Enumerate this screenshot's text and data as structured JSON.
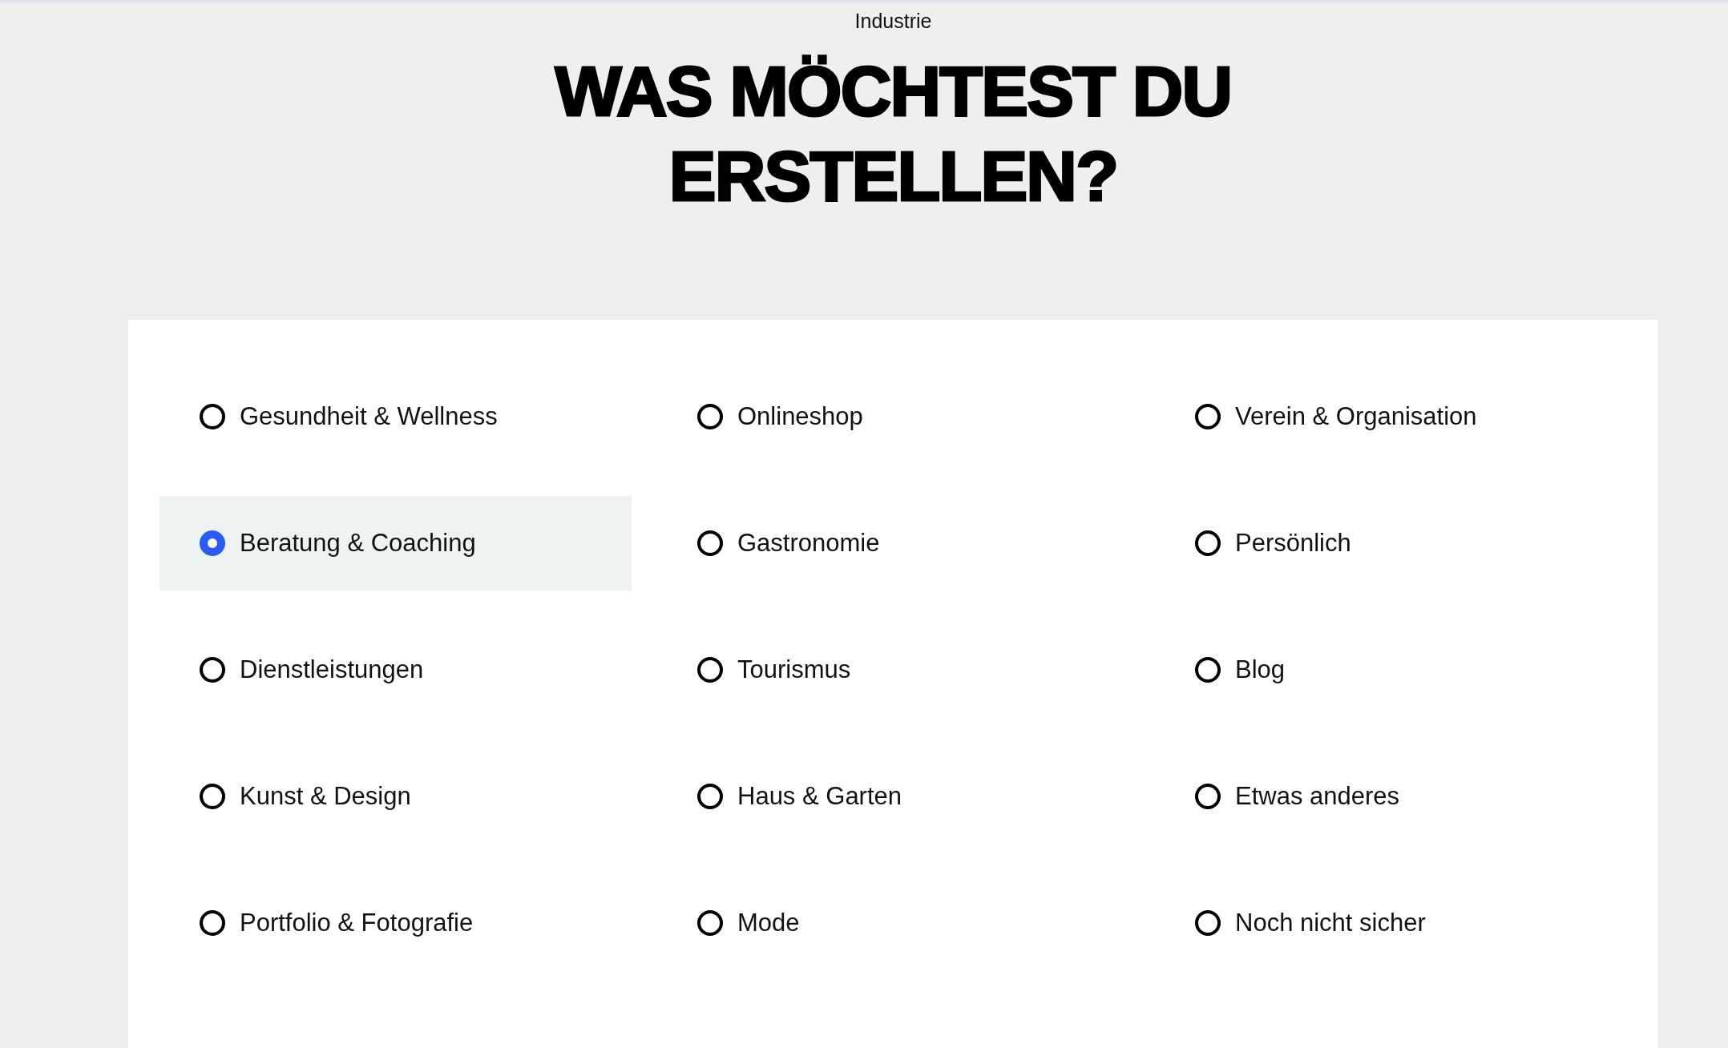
{
  "page": {
    "eyebrow": "Industrie",
    "title": "WAS MÖCHTEST DU ERSTELLEN?"
  },
  "options": [
    {
      "label": "Gesundheit & Wellness",
      "selected": false
    },
    {
      "label": "Onlineshop",
      "selected": false
    },
    {
      "label": "Verein & Organisation",
      "selected": false
    },
    {
      "label": "Beratung & Coaching",
      "selected": true
    },
    {
      "label": "Gastronomie",
      "selected": false
    },
    {
      "label": "Persönlich",
      "selected": false
    },
    {
      "label": "Dienstleistungen",
      "selected": false
    },
    {
      "label": "Tourismus",
      "selected": false
    },
    {
      "label": "Blog",
      "selected": false
    },
    {
      "label": "Kunst & Design",
      "selected": false
    },
    {
      "label": "Haus & Garten",
      "selected": false
    },
    {
      "label": "Etwas anderes",
      "selected": false
    },
    {
      "label": "Portfolio & Fotografie",
      "selected": false
    },
    {
      "label": "Mode",
      "selected": false
    },
    {
      "label": "Noch nicht sicher",
      "selected": false
    }
  ]
}
